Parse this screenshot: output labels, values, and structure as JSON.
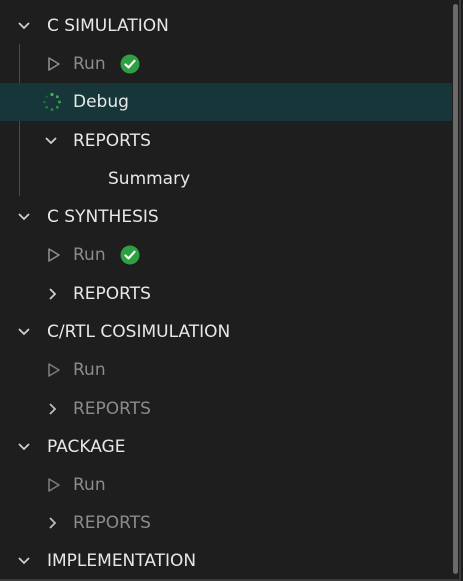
{
  "sections": [
    {
      "title": "C SIMULATION",
      "run_label": "Run",
      "debug_label": "Debug",
      "reports_label": "REPORTS",
      "summary_label": "Summary"
    },
    {
      "title": "C SYNTHESIS",
      "run_label": "Run",
      "reports_label": "REPORTS"
    },
    {
      "title": "C/RTL COSIMULATION",
      "run_label": "Run",
      "reports_label": "REPORTS"
    },
    {
      "title": "PACKAGE",
      "run_label": "Run",
      "reports_label": "REPORTS"
    },
    {
      "title": "IMPLEMENTATION"
    }
  ],
  "colors": {
    "background": "#1e1e1e",
    "selected_row": "#17363a",
    "success_green": "#2ea043",
    "spinner_green": "#3fb950",
    "dim_text": "#8c8c8c",
    "text": "#e8e8e8"
  },
  "icons": {
    "expanded": "chevron-down-icon",
    "collapsed": "chevron-right-icon",
    "run": "play-outline-icon",
    "success": "check-circle-icon",
    "in_progress": "spinner-icon"
  }
}
